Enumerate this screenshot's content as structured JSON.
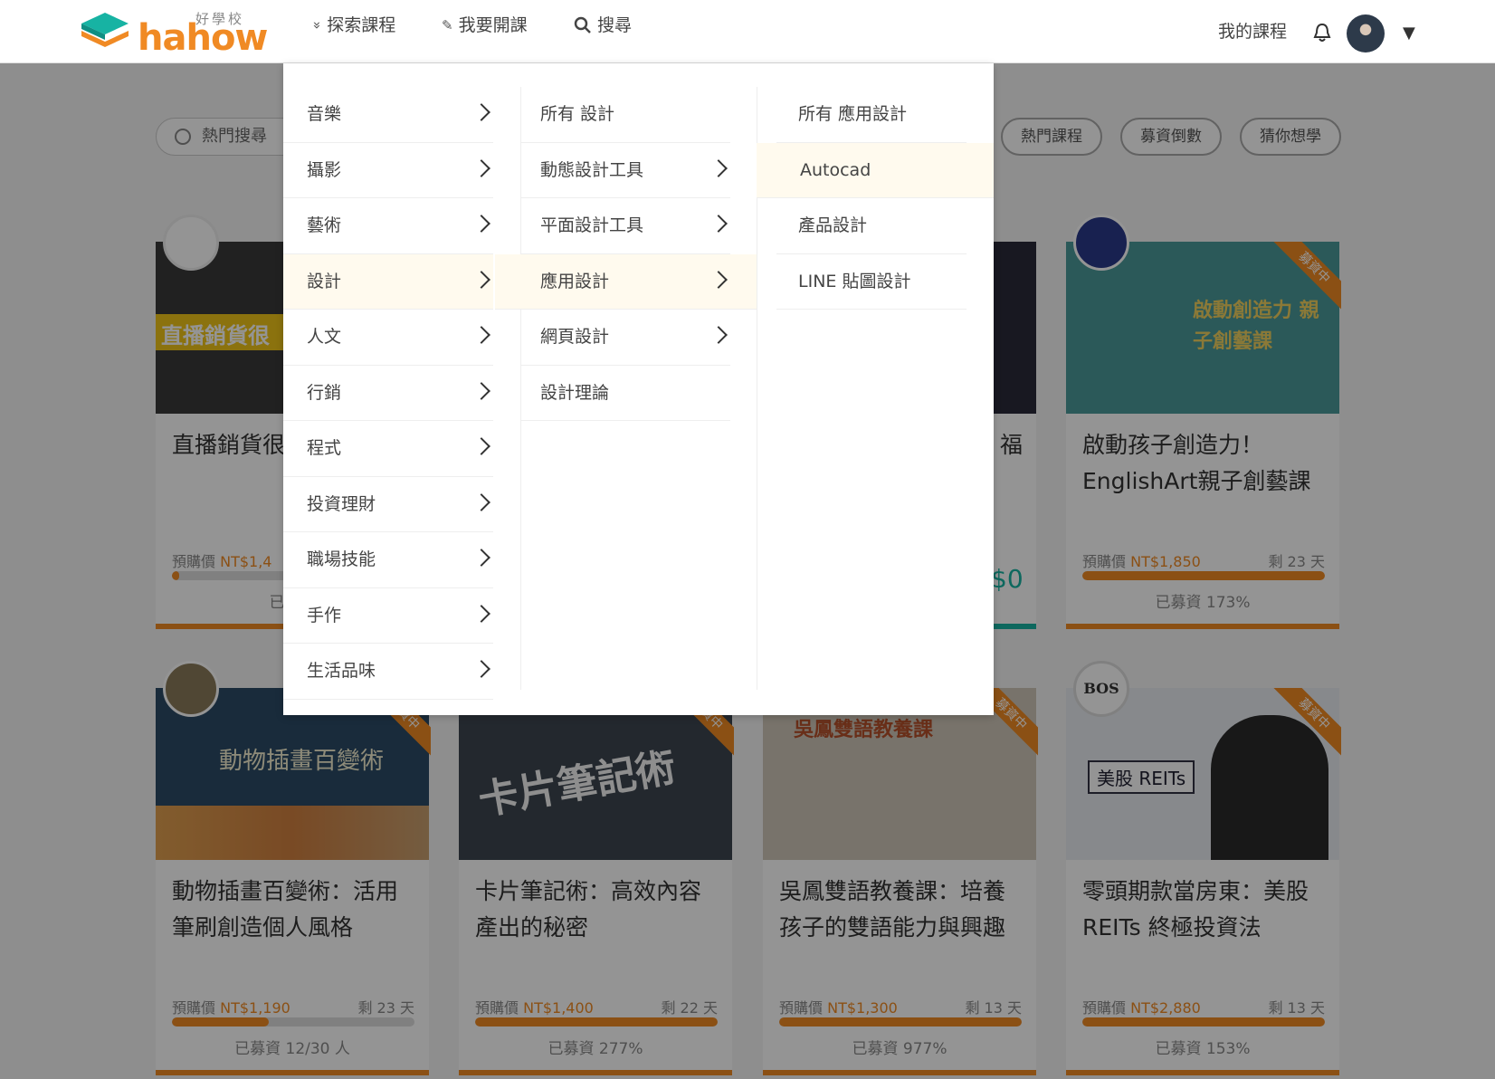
{
  "header": {
    "logo_text": "hahow",
    "logo_sub": "好學校",
    "nav": [
      {
        "icon": "double-chevron-down-icon",
        "glyph": "»",
        "label": "探索課程"
      },
      {
        "icon": "pencil-icon",
        "glyph": "✎",
        "label": "我要開課"
      },
      {
        "icon": "search-icon",
        "glyph": "⌕",
        "label": "搜尋"
      }
    ],
    "my_courses": "我的課程",
    "caret": "▼"
  },
  "search": {
    "placeholder": "熱門搜尋"
  },
  "chips": [
    "熱門課程",
    "募資倒數",
    "猜你想學"
  ],
  "mega_menu": {
    "categories": [
      "音樂",
      "攝影",
      "藝術",
      "設計",
      "人文",
      "行銷",
      "程式",
      "投資理財",
      "職場技能",
      "手作",
      "生活品味"
    ],
    "active_category": 3,
    "subcategories": [
      {
        "label": "所有 設計",
        "has_children": false
      },
      {
        "label": "動態設計工具",
        "has_children": true
      },
      {
        "label": "平面設計工具",
        "has_children": true
      },
      {
        "label": "應用設計",
        "has_children": true
      },
      {
        "label": "網頁設計",
        "has_children": true
      },
      {
        "label": "設計理論",
        "has_children": false
      }
    ],
    "active_subcategory": 3,
    "items": [
      "所有 應用設計",
      "Autocad",
      "產品設計",
      "LINE 貼圖設計"
    ],
    "hover_item": 1
  },
  "cards_row1": [
    {
      "title": "直播銷貨很 次導購直播",
      "price_label": "預購價",
      "price": "NT$1,4",
      "days": "",
      "raised": "已募資",
      "progress": 0.02,
      "thumb_color": "#3a3a3a",
      "accent": "#f08a24",
      "thumb_caption": "直播銷貨很"
    },
    {
      "title": "啟動孩子創造力！EnglishArt親子創藝課",
      "price_label": "預購價",
      "price": "NT$1,850",
      "days": "剩 23 天",
      "raised": "已募資 173%",
      "progress": 1.0,
      "thumb_color": "#4a9a9a",
      "accent": "#f08a24",
      "thumb_caption": "啟動創造力 親子創藝課",
      "badge": "募資中"
    }
  ],
  "partial_card": {
    "title_fragment": "福",
    "price_fragment": "$0"
  },
  "cards_row2": [
    {
      "title": "動物插畫百變術：活用筆刷創造個人風格",
      "price_label": "預購價",
      "price": "NT$1,190",
      "days": "剩 23 天",
      "raised": "已募資 12/30 人",
      "progress": 0.4,
      "thumb_color": "#2c4a66",
      "badge": "募資中",
      "thumb_caption": "動物插畫百變術"
    },
    {
      "title": "卡片筆記術：高效內容產出的秘密",
      "price_label": "預購價",
      "price": "NT$1,400",
      "days": "剩 22 天",
      "raised": "已募資 277%",
      "progress": 1.0,
      "thumb_color": "#3d4650",
      "badge": "募資中",
      "thumb_caption": "卡片筆記術"
    },
    {
      "title": "吳鳳雙語教養課：培養孩子的雙語能力與興趣",
      "price_label": "預購價",
      "price": "NT$1,300",
      "days": "剩 13 天",
      "raised": "已募資 977%",
      "progress": 1.0,
      "thumb_color": "#cfc6b8",
      "badge": "募資中",
      "thumb_caption": "吳鳳雙語教養課"
    },
    {
      "title": "零頭期款當房東：美股REITs 終極投資法",
      "price_label": "預購價",
      "price": "NT$2,880",
      "days": "剩 13 天",
      "raised": "已募資 153%",
      "progress": 1.0,
      "thumb_color": "#e8edf2",
      "badge": "募資中",
      "thumb_caption": "美股 REITs",
      "avatar_text": "BOS"
    }
  ]
}
